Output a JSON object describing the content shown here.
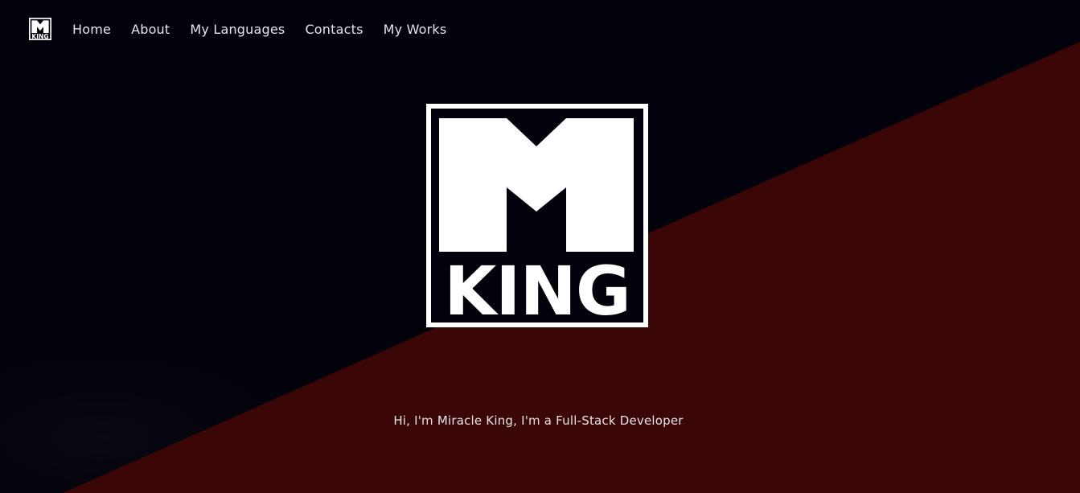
{
  "colors": {
    "background_dark": "#02020c",
    "background_red": "#3b0606",
    "foreground": "#ffffff",
    "nav_text": "#e6e6ea"
  },
  "nav": {
    "logo_text": "KING",
    "links": [
      {
        "label": "Home"
      },
      {
        "label": "About"
      },
      {
        "label": "My Languages"
      },
      {
        "label": "Contacts"
      },
      {
        "label": "My Works"
      }
    ]
  },
  "hero": {
    "logo_letter": "M",
    "logo_word": "KING",
    "tagline": "Hi, I'm Miracle King, I'm a Full-Stack Developer"
  }
}
